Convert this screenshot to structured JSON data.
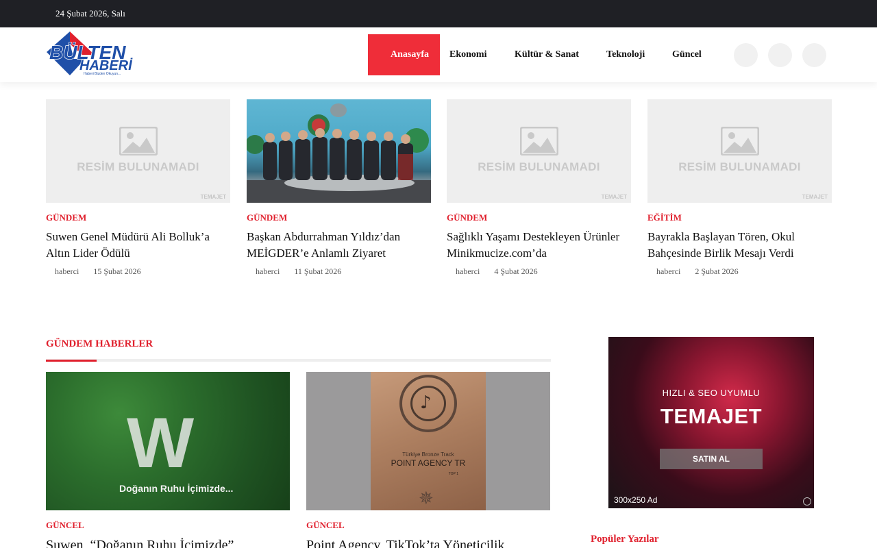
{
  "topbar": {
    "date": "24 Şubat 2026, Salı"
  },
  "colors": {
    "accent": "#ef2d39",
    "category": "#e0212e",
    "topbar": "#1f2025"
  },
  "header": {
    "logo": {
      "main": "BÜLTEN",
      "sub": "HABERİ",
      "tagline": "Haberi Bizden Okuyun..."
    },
    "nav": [
      "Anasayfa",
      "Ekonomi",
      "Kültür & Sanat",
      "Teknoloji",
      "Güncel"
    ],
    "icons": [
      "search-icon",
      "user-icon",
      "menu-icon"
    ]
  },
  "placeholder": {
    "text": "RESİM BULUNAMADI",
    "brand": "TEMAJET"
  },
  "cards": [
    {
      "category": "GÜNDEM",
      "title": "Suwen Genel Müdürü Ali Bolluk’a Altın Lider Ödülü",
      "author": "haberci",
      "date": "15 Şubat 2026"
    },
    {
      "category": "GÜNDEM",
      "title": "Başkan Abdurrahman Yıldız’dan MEİGDER’e Anlamlı Ziyaret",
      "author": "haberci",
      "date": "11 Şubat 2026"
    },
    {
      "category": "GÜNDEM",
      "title": "Sağlıklı Yaşamı Destekleyen Ürünler Minikmucize.com’da",
      "author": "haberci",
      "date": "4 Şubat 2026"
    },
    {
      "category": "EĞİTİM",
      "title": "Bayrakla Başlayan Tören, Okul Bahçesinde Birlik Mesajı Verdi",
      "author": "haberci",
      "date": "2 Şubat 2026"
    }
  ],
  "section": {
    "title": "GÜNDEM HABERLER",
    "items": [
      {
        "category": "GÜNCEL",
        "title": "Suwen, “Doğanın Ruhu İçimizde”",
        "image_caption": "Doğanın Ruhu İçimizde..."
      },
      {
        "category": "GÜNCEL",
        "title": " Point Agency, TikTok’ta Yöneticilik",
        "plaque_line1": "Türkiye Bronze Track",
        "plaque_line2": "POINT AGENCY TR",
        "plaque_line3": "TOP 1"
      }
    ]
  },
  "ad": {
    "line1": "HIZLI & SEO UYUMLU",
    "line2": "TEMAJET",
    "button": "SATIN AL",
    "size": "300x250 Ad"
  },
  "sidebar": {
    "popular_title": "Popüler Yazılar"
  }
}
